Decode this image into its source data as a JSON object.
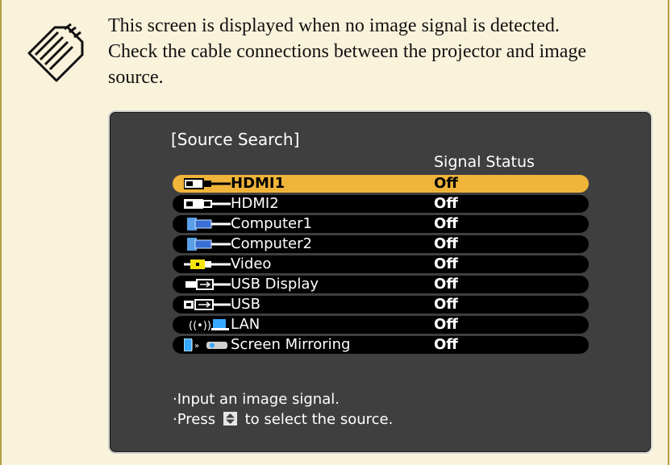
{
  "note": {
    "text_lines": [
      "This screen is displayed when no image signal is detected.",
      "Check the cable connections between the projector and image",
      "source."
    ]
  },
  "projector_screen": {
    "title": "[Source Search]",
    "status_header": "Signal Status",
    "sources": [
      {
        "label": "HDMI1",
        "status": "Off",
        "icon": "hdmi-icon",
        "selected": true
      },
      {
        "label": "HDMI2",
        "status": "Off",
        "icon": "hdmi-icon",
        "selected": false
      },
      {
        "label": "Computer1",
        "status": "Off",
        "icon": "computer-icon",
        "selected": false
      },
      {
        "label": "Computer2",
        "status": "Off",
        "icon": "computer-icon",
        "selected": false
      },
      {
        "label": "Video",
        "status": "Off",
        "icon": "video-icon",
        "selected": false
      },
      {
        "label": "USB Display",
        "status": "Off",
        "icon": "usb-display-icon",
        "selected": false
      },
      {
        "label": "USB",
        "status": "Off",
        "icon": "usb-icon",
        "selected": false
      },
      {
        "label": "LAN",
        "status": "Off",
        "icon": "lan-icon",
        "selected": false
      },
      {
        "label": "Screen Mirroring",
        "status": "Off",
        "icon": "screen-mirroring-icon",
        "selected": false
      }
    ],
    "instructions": {
      "line1": "·Input an image signal.",
      "line2_prefix": "·Press",
      "line2_suffix": "to select the source."
    },
    "colors": {
      "selected_bar": "#f1b43a",
      "screen_bg": "#3f3f3f",
      "row_bg": "#000000"
    }
  }
}
